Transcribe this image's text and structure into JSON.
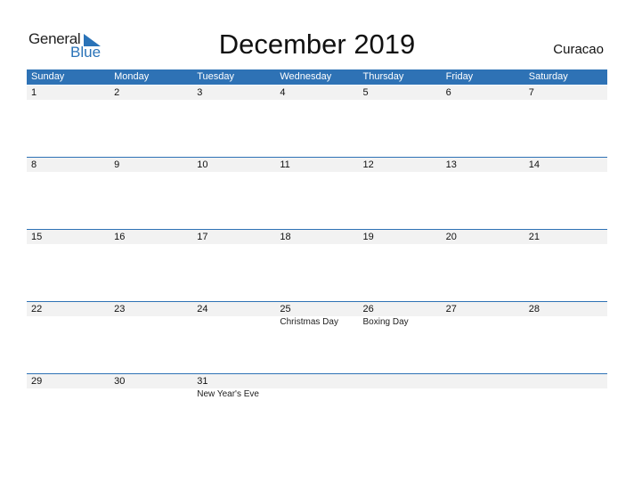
{
  "logo": {
    "word1": "General",
    "word2": "Blue"
  },
  "title": "December 2019",
  "country": "Curacao",
  "colors": {
    "accent": "#2e72b5",
    "row_bg": "#f2f2f2"
  },
  "weekdays": [
    "Sunday",
    "Monday",
    "Tuesday",
    "Wednesday",
    "Thursday",
    "Friday",
    "Saturday"
  ],
  "weeks": [
    {
      "days": [
        "1",
        "2",
        "3",
        "4",
        "5",
        "6",
        "7"
      ],
      "events": [
        "",
        "",
        "",
        "",
        "",
        "",
        ""
      ]
    },
    {
      "days": [
        "8",
        "9",
        "10",
        "11",
        "12",
        "13",
        "14"
      ],
      "events": [
        "",
        "",
        "",
        "",
        "",
        "",
        ""
      ]
    },
    {
      "days": [
        "15",
        "16",
        "17",
        "18",
        "19",
        "20",
        "21"
      ],
      "events": [
        "",
        "",
        "",
        "",
        "",
        "",
        ""
      ]
    },
    {
      "days": [
        "22",
        "23",
        "24",
        "25",
        "26",
        "27",
        "28"
      ],
      "events": [
        "",
        "",
        "",
        "Christmas Day",
        "Boxing Day",
        "",
        ""
      ]
    },
    {
      "days": [
        "29",
        "30",
        "31",
        "",
        "",
        "",
        ""
      ],
      "events": [
        "",
        "",
        "New Year's Eve",
        "",
        "",
        "",
        ""
      ]
    }
  ]
}
